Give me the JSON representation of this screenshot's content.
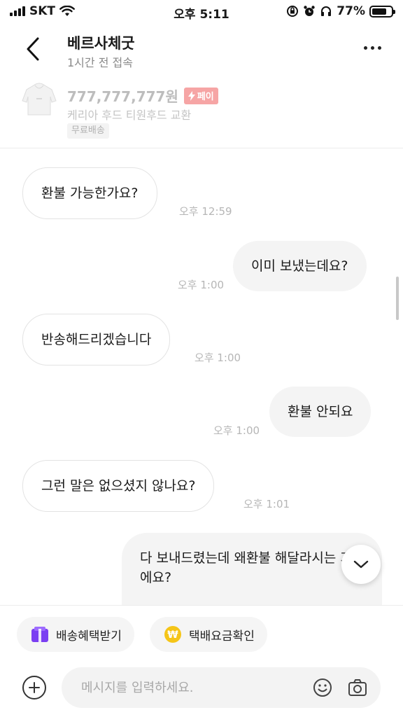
{
  "status_bar": {
    "carrier": "SKT",
    "time": "오후 5:11",
    "battery": "77%",
    "battery_level": 0.77
  },
  "header": {
    "title": "베르사체굿",
    "subtitle": "1시간 전 접속"
  },
  "product": {
    "price": "777,777,777원",
    "pay_badge": "페이",
    "name": "케리아 후드 티원후드 교환",
    "shipping_tag": "무료배송"
  },
  "messages": [
    {
      "side": "in",
      "text": "환불 가능한가요?",
      "time": "오후 12:59"
    },
    {
      "side": "out",
      "text": "이미 보냈는데요?",
      "time": "오후 1:00"
    },
    {
      "side": "in",
      "text": "반송해드리겠습니다",
      "time": "오후 1:00"
    },
    {
      "side": "out",
      "text": "환불 안되요",
      "time": "오후 1:00"
    },
    {
      "side": "in",
      "text": "그런 말은 없으셨지 않나요?",
      "time": "오후 1:01"
    },
    {
      "side": "out",
      "text": "다 보내드렸는데 왜환불 해달라시는 거에요?",
      "time": ""
    }
  ],
  "quick_actions": {
    "delivery": "배송혜택받기",
    "fee": "택배요금확인"
  },
  "composer": {
    "placeholder": "메시지를 입력하세요."
  },
  "colors": {
    "pay_badge": "#f6a5a5",
    "delivery_icon": "#7b3ff2",
    "fee_icon": "#f5c518"
  }
}
